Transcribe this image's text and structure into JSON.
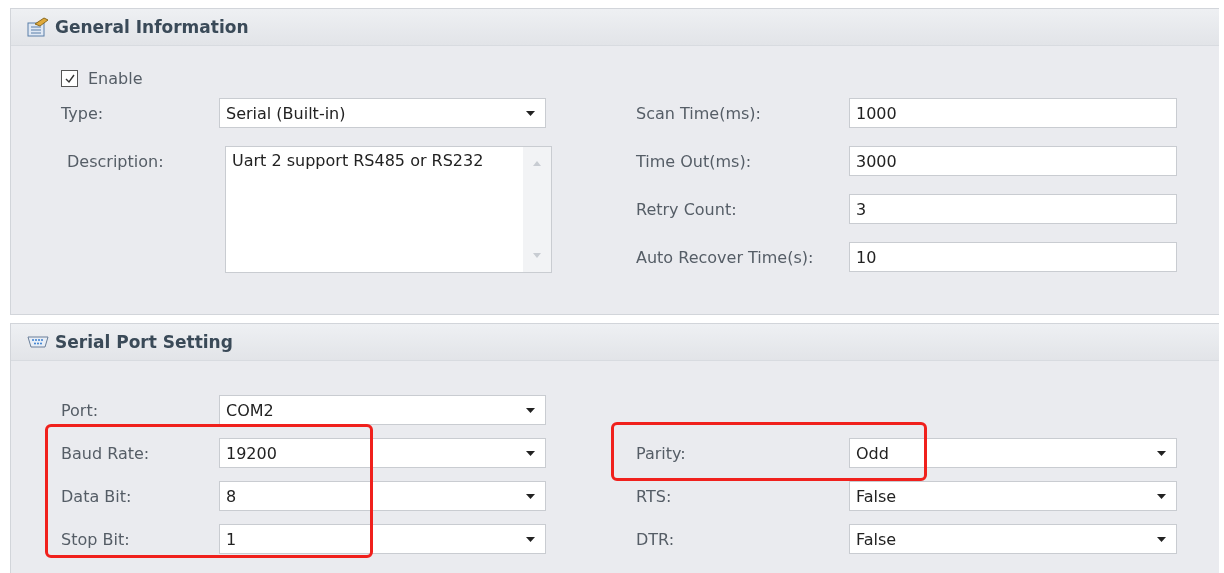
{
  "sections": [
    {
      "title": "General Information",
      "checkbox": {
        "label": "Enable",
        "checked": true
      },
      "left": [
        {
          "fields": [
            {
              "label": "Type:",
              "kind": "dropdown",
              "value": "Serial (Built-in)"
            },
            {
              "label": "Description:",
              "kind": "memo",
              "value": "Uart 2 support RS485 or RS232"
            }
          ],
          "highlighted": false
        }
      ],
      "right": [
        {
          "fields": [
            {
              "label": "Scan Time(ms):",
              "kind": "text",
              "value": "1000"
            },
            {
              "label": "Time Out(ms):",
              "kind": "text",
              "value": "3000"
            },
            {
              "label": "Retry Count:",
              "kind": "text",
              "value": "3"
            },
            {
              "label": "Auto Recover Time(s):",
              "kind": "text",
              "value": "10"
            }
          ],
          "highlighted": false
        }
      ]
    },
    {
      "title": "Serial Port Setting",
      "left": [
        {
          "fields": [
            {
              "label": "Port:",
              "kind": "dropdown",
              "value": "COM2"
            }
          ],
          "highlighted": false
        },
        {
          "fields": [
            {
              "label": "Baud Rate:",
              "kind": "dropdown",
              "value": "19200"
            },
            {
              "label": "Data Bit:",
              "kind": "dropdown",
              "value": "8"
            },
            {
              "label": "Stop Bit:",
              "kind": "dropdown",
              "value": "1"
            }
          ],
          "highlighted": true
        }
      ],
      "right": [
        {
          "highlighted": false
        },
        {
          "fields": [
            {
              "label": "Parity:",
              "kind": "dropdown",
              "value": "Odd"
            }
          ],
          "highlighted": true
        },
        {
          "fields": [
            {
              "label": "RTS:",
              "kind": "dropdown",
              "value": "False"
            },
            {
              "label": "DTR:",
              "kind": "dropdown",
              "value": "False"
            }
          ],
          "highlighted": false
        }
      ]
    }
  ]
}
